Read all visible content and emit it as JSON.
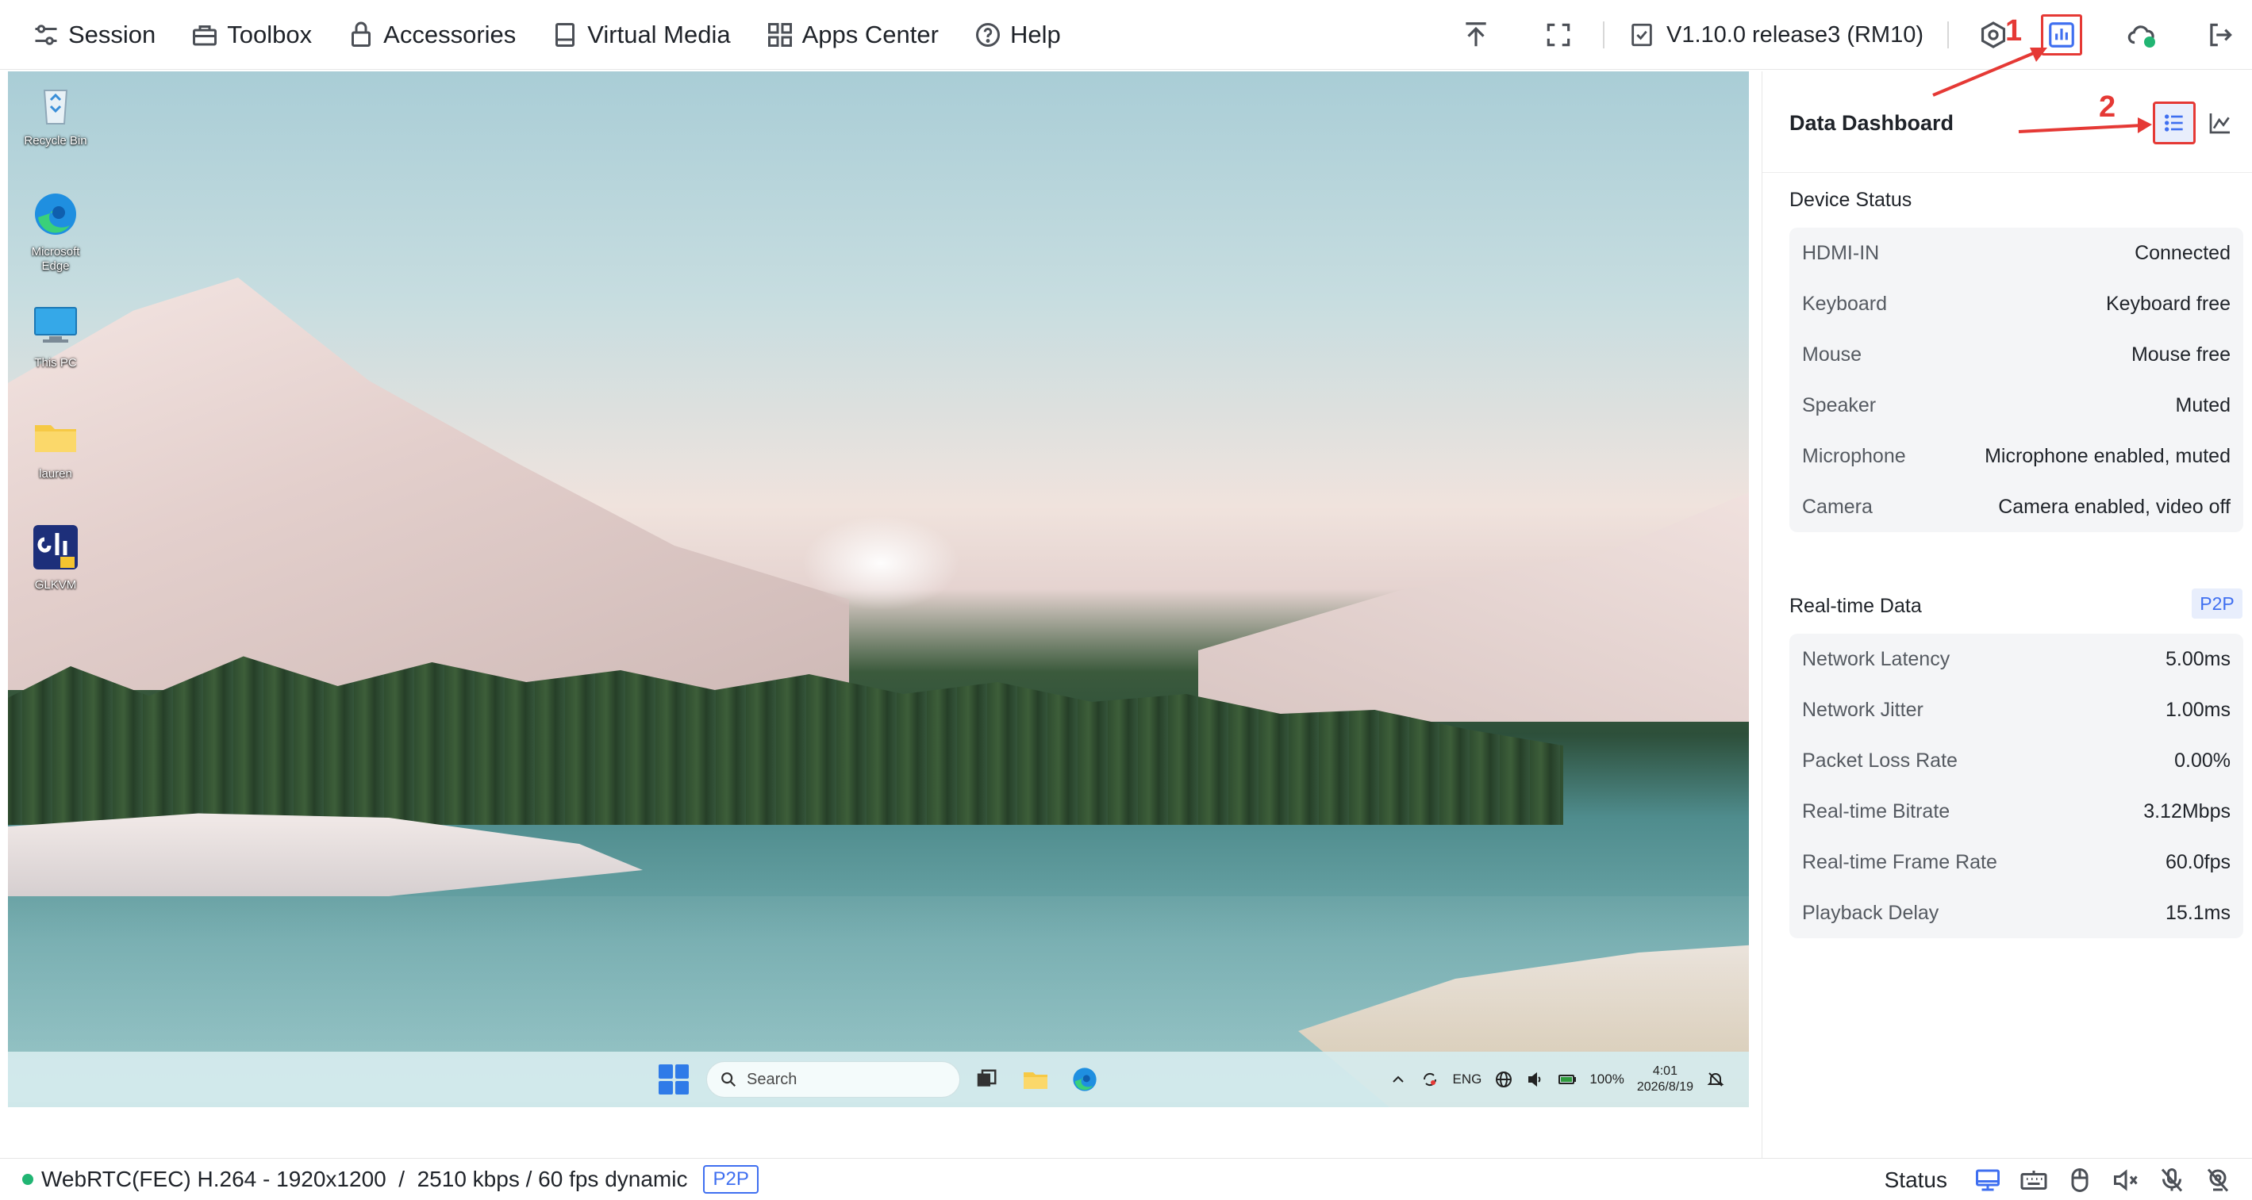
{
  "menu": [
    {
      "label": "Session",
      "icon": "sliders-icon"
    },
    {
      "label": "Toolbox",
      "icon": "toolbox-icon"
    },
    {
      "label": "Accessories",
      "icon": "lock-icon"
    },
    {
      "label": "Virtual Media",
      "icon": "drive-icon"
    },
    {
      "label": "Apps Center",
      "icon": "apps-grid-icon"
    },
    {
      "label": "Help",
      "icon": "question-icon"
    }
  ],
  "toolbar": {
    "version": "V1.10.0 release3 (RM10)"
  },
  "desktop": {
    "icons": [
      "Recycle Bin",
      "Microsoft Edge",
      "This PC",
      "lauren",
      "GLKVM"
    ],
    "search_placeholder": "Search",
    "tray_lang": "ENG",
    "battery": "100%",
    "time": "4:01",
    "date": "2026/8/19"
  },
  "panel": {
    "title": "Data Dashboard",
    "device_status": {
      "title": "Device Status",
      "rows": [
        {
          "label": "HDMI-IN",
          "value": "Connected"
        },
        {
          "label": "Keyboard",
          "value": "Keyboard free"
        },
        {
          "label": "Mouse",
          "value": "Mouse free"
        },
        {
          "label": "Speaker",
          "value": "Muted"
        },
        {
          "label": "Microphone",
          "value": "Microphone enabled, muted"
        },
        {
          "label": "Camera",
          "value": "Camera enabled, video off"
        }
      ]
    },
    "realtime": {
      "title": "Real-time Data",
      "badge": "P2P",
      "rows": [
        {
          "label": "Network Latency",
          "value": "5.00ms"
        },
        {
          "label": "Network Jitter",
          "value": "1.00ms"
        },
        {
          "label": "Packet Loss Rate",
          "value": "0.00%"
        },
        {
          "label": "Real-time Bitrate",
          "value": "3.12Mbps"
        },
        {
          "label": "Real-time Frame Rate",
          "value": "60.0fps"
        },
        {
          "label": "Playback Delay",
          "value": "15.1ms"
        }
      ]
    }
  },
  "annotations": {
    "one": "1",
    "two": "2"
  },
  "statusbar": {
    "stream_info": "WebRTC(FEC) H.264 - 1920x1200  /  2510 kbps / 60 fps dynamic",
    "p2p": "P2P",
    "status_label": "Status"
  },
  "colors": {
    "accent": "#3f6ff0",
    "annotation": "#e53935",
    "online": "#21b573"
  }
}
